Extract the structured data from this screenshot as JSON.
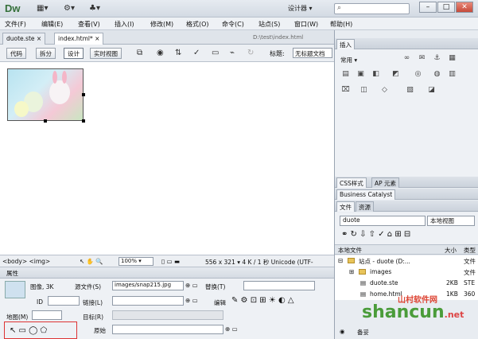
{
  "app": {
    "logo": "Dw",
    "workspace": "设计器 ▾",
    "search_icon": "⌕"
  },
  "window_buttons": [
    "–",
    "□",
    "✕"
  ],
  "menu": [
    "文件(F)",
    "编辑(E)",
    "查看(V)",
    "插入(I)",
    "修改(M)",
    "格式(O)",
    "命令(C)",
    "站点(S)",
    "窗口(W)",
    "帮助(H)"
  ],
  "doc_tabs": [
    "duote.ste ×",
    "index.html* ×"
  ],
  "doc_path": "D:\\test\\index.html",
  "view_buttons": [
    "代码",
    "拆分",
    "设计",
    "实时视图"
  ],
  "title_label": "标题:",
  "title_value": "无标题文档",
  "status": {
    "tags": "<body> <img>",
    "zoom": "100% ▾",
    "size": "556 x 321 ▾ 4 K / 1 秒 Unicode (UTF-"
  },
  "properties": {
    "header": "属性",
    "image_label": "图像, 3K",
    "id_label": "ID",
    "src_label": "源文件(S)",
    "src_value": "images/snap215.jpg",
    "alt_label": "替换(T)",
    "link_label": "链接(L)",
    "edit_label": "编辑",
    "map_label": "地图(M)",
    "target_label": "目标(R)",
    "original_label": "原始"
  },
  "right_panel": {
    "insert_tab": "插入",
    "insert_category": "常用 ▾",
    "css_tab": "CSS样式",
    "ap_tab": "AP 元素",
    "bc_tab": "Business Catalyst",
    "files_tab": "文件",
    "assets_tab": "资源",
    "site_select": "duote",
    "view_select": "本地视图",
    "col_local": "本地文件",
    "col_size": "大小",
    "col_type": "类型",
    "files": [
      {
        "name": "站点 - duote (D:...",
        "size": "",
        "type": "文件"
      },
      {
        "name": "images",
        "size": "",
        "type": "文件"
      },
      {
        "name": "duote.ste",
        "size": "2KB",
        "type": "STE"
      },
      {
        "name": "home.html",
        "size": "1KB",
        "type": "360"
      }
    ],
    "bottom_label": "备妥"
  },
  "watermark": {
    "main": "shancun",
    "small": ".net",
    "cn": "山村软件网"
  }
}
